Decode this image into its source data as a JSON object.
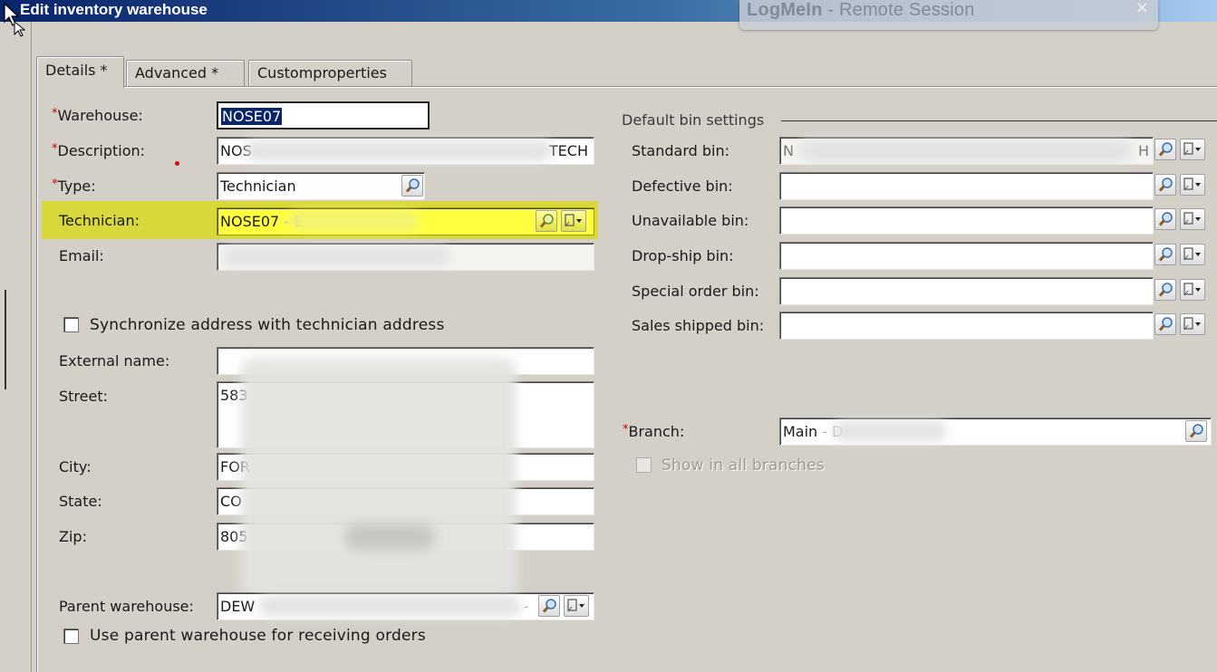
{
  "window": {
    "title": "Edit inventory warehouse"
  },
  "session_banner": {
    "brand": "LogMeIn",
    "separator": " - ",
    "text": "Remote Session",
    "close": "×"
  },
  "tabs": [
    {
      "label": "Details *",
      "active": true
    },
    {
      "label": "Advanced *",
      "active": false
    },
    {
      "label": "Customproperties",
      "active": false
    }
  ],
  "form": {
    "required_mark": "*",
    "warehouse": {
      "label": "Warehouse:",
      "value": "NOSE07"
    },
    "description": {
      "label": "Description:",
      "value_start": "NOS",
      "value_end": "TECH"
    },
    "type": {
      "label": "Type:",
      "value": "Technician"
    },
    "technician": {
      "label": "Technician:",
      "value": "NOSE07",
      "suffix": " - E"
    },
    "email": {
      "label": "Email:"
    },
    "sync_address": {
      "label": "Synchronize address with technician address",
      "checked": false
    },
    "external_name": {
      "label": "External name:",
      "value": ""
    },
    "street": {
      "label": "Street:",
      "value": "583"
    },
    "city": {
      "label": "City:",
      "value": "FOR"
    },
    "state": {
      "label": "State:",
      "value": "CO"
    },
    "zip": {
      "label": "Zip:",
      "value": "805"
    },
    "parent_warehouse": {
      "label": "Parent warehouse:",
      "value": "DEW",
      "suffix": "-"
    },
    "use_parent": {
      "label": "Use parent warehouse for receiving orders",
      "checked": false
    }
  },
  "bins": {
    "group_title": "Default bin settings",
    "standard": {
      "label": "Standard bin:",
      "value_start": "N",
      "value_end": "H"
    },
    "defective": {
      "label": "Defective bin:",
      "value": ""
    },
    "unavailable": {
      "label": "Unavailable bin:",
      "value": ""
    },
    "dropship": {
      "label": "Drop-ship bin:",
      "value": ""
    },
    "special_order": {
      "label": "Special order bin:",
      "value": ""
    },
    "sales_shipped": {
      "label": "Sales shipped bin:",
      "value": ""
    }
  },
  "branch": {
    "label": "Branch:",
    "value": "Main",
    "suffix": " - D",
    "show_all": {
      "label": "Show in all branches",
      "checked": false,
      "enabled": false
    }
  },
  "colors": {
    "highlight": "#ffff40",
    "selection": "#0a246a",
    "required": "#cc0000"
  },
  "icons": [
    "cursor-icon",
    "search-icon",
    "menu-dropdown-icon",
    "close-icon"
  ]
}
